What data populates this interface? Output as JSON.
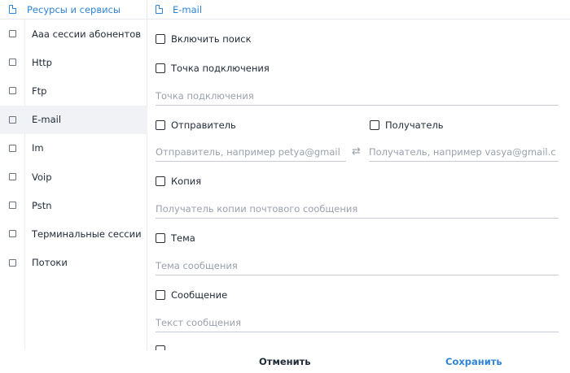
{
  "left_panel": {
    "header": "Ресурсы и сервисы",
    "items": [
      {
        "label": "Aaa сессии абонентов"
      },
      {
        "label": "Http"
      },
      {
        "label": "Ftp"
      },
      {
        "label": "E-mail"
      },
      {
        "label": "Im"
      },
      {
        "label": "Voip"
      },
      {
        "label": "Pstn"
      },
      {
        "label": "Терминальные сессии"
      },
      {
        "label": "Потоки"
      }
    ],
    "selected": "E-mail"
  },
  "right_panel": {
    "header": "E-mail",
    "enable_search": "Включить поиск",
    "connection_point": {
      "label": "Точка подключения",
      "placeholder": "Точка подключения"
    },
    "sender": {
      "label": "Отправитель",
      "placeholder": "Отправитель, например petya@gmail"
    },
    "recipient": {
      "label": "Получатель",
      "placeholder": "Получатель, например vasya@gmail.c"
    },
    "copy": {
      "label": "Копия",
      "placeholder": "Получатель копии почтового сообщения"
    },
    "subject": {
      "label": "Тема",
      "placeholder": "Тема сообщения"
    },
    "message": {
      "label": "Сообщение",
      "placeholder": "Текст сообщения"
    }
  },
  "footer": {
    "cancel": "Отменить",
    "save": "Сохранить"
  }
}
